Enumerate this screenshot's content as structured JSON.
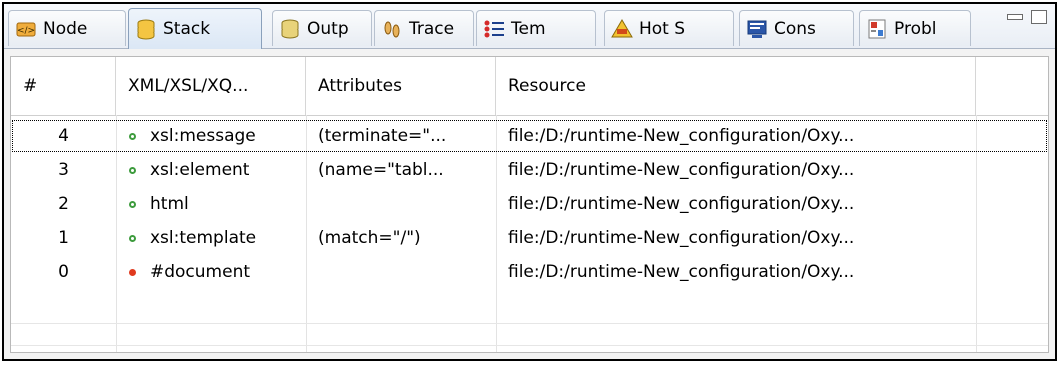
{
  "tabs": [
    {
      "label": "Node",
      "icon": "node-icon",
      "active": false
    },
    {
      "label": "Stack",
      "icon": "stack-icon",
      "active": true
    },
    {
      "label": "Outp",
      "icon": "output-icon",
      "active": false
    },
    {
      "label": "Trace",
      "icon": "trace-icon",
      "active": false
    },
    {
      "label": "Tem",
      "icon": "templates-icon",
      "active": false
    },
    {
      "label": "Hot S",
      "icon": "hotspots-icon",
      "active": false
    },
    {
      "label": "Cons",
      "icon": "console-icon",
      "active": false
    },
    {
      "label": "Probl",
      "icon": "problems-icon",
      "active": false
    }
  ],
  "table": {
    "columns": [
      "#",
      "XML/XSL/XQ...",
      "Attributes",
      "Resource"
    ],
    "rows": [
      {
        "num": "4",
        "name": "xsl:message",
        "attributes": "(terminate=\"...",
        "resource": "file:/D:/runtime-New_configuration/Oxy...",
        "status": "green",
        "selected": true
      },
      {
        "num": "3",
        "name": "xsl:element",
        "attributes": "(name=\"tabl...",
        "resource": "file:/D:/runtime-New_configuration/Oxy...",
        "status": "green",
        "selected": false
      },
      {
        "num": "2",
        "name": "html",
        "attributes": "",
        "resource": "file:/D:/runtime-New_configuration/Oxy...",
        "status": "green",
        "selected": false
      },
      {
        "num": "1",
        "name": "xsl:template",
        "attributes": "(match=\"/\")",
        "resource": "file:/D:/runtime-New_configuration/Oxy...",
        "status": "green",
        "selected": false
      },
      {
        "num": "0",
        "name": "#document",
        "attributes": "",
        "resource": "file:/D:/runtime-New_configuration/Oxy...",
        "status": "red",
        "selected": false
      }
    ]
  },
  "colors": {
    "status_green": "#3d9b3d",
    "status_red": "#e03a1e"
  }
}
